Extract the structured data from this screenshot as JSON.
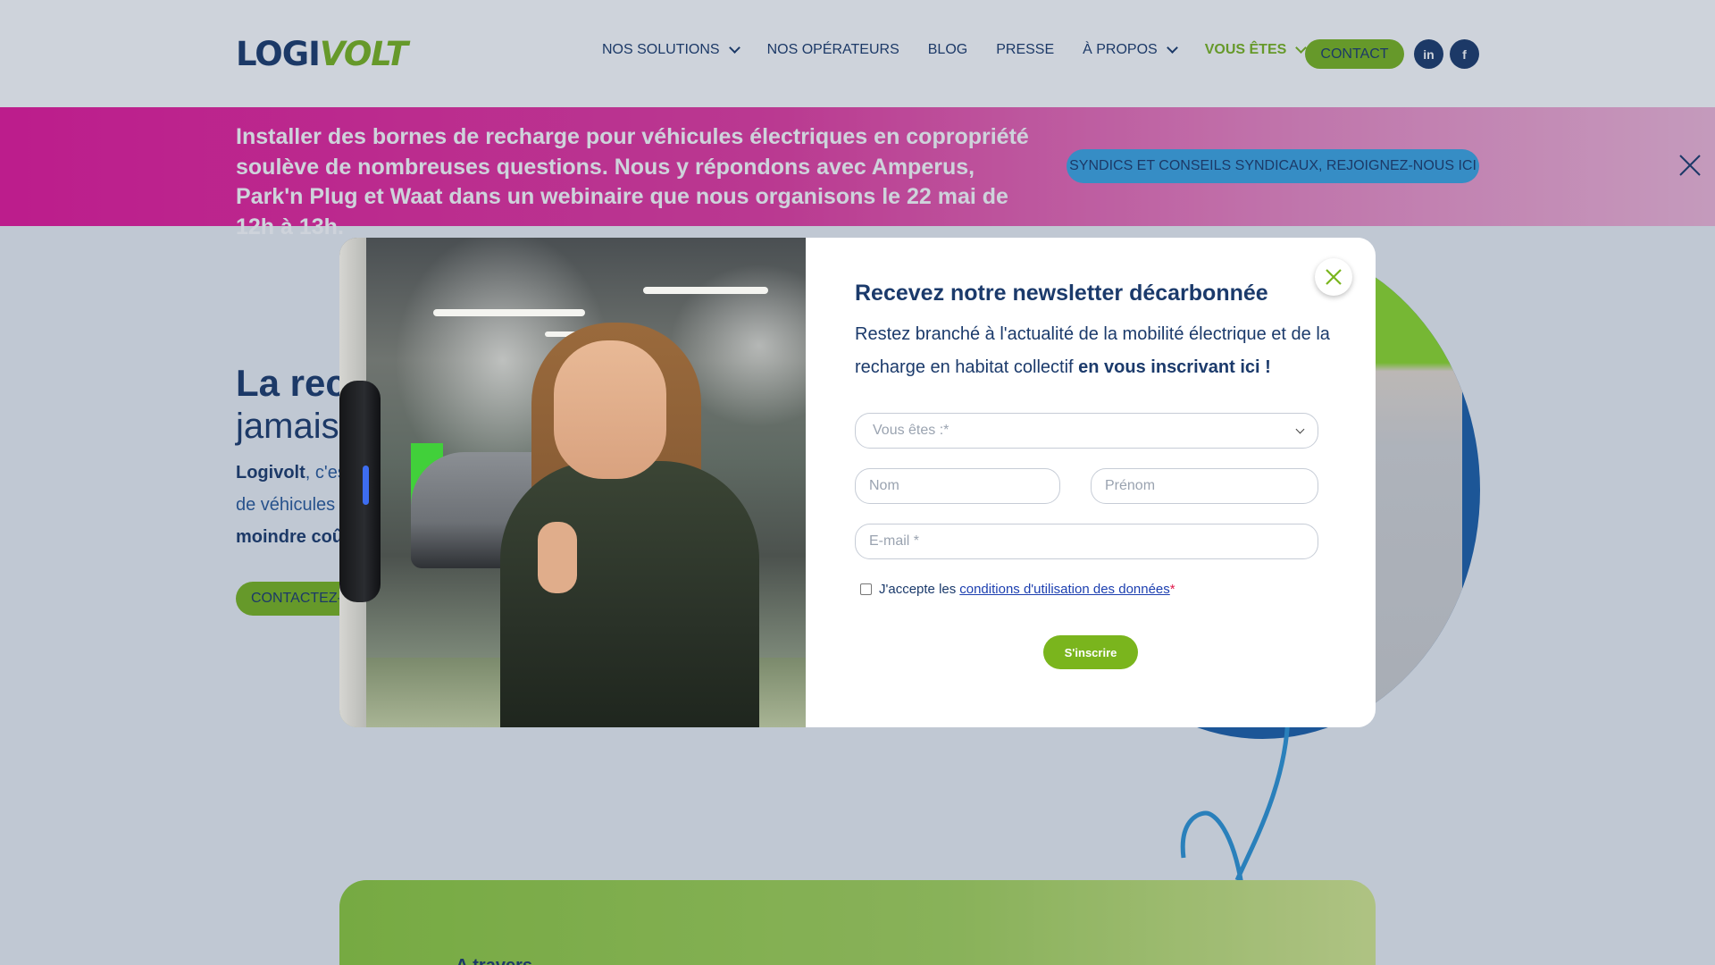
{
  "brand": {
    "logo_part1": "LOGI",
    "logo_part2": "VOLT",
    "primary_color": "#1b3a6b",
    "accent_color": "#7ab51d"
  },
  "nav": {
    "items": [
      {
        "label": "NOS SOLUTIONS",
        "dropdown": true
      },
      {
        "label": "NOS OPÉRATEURS",
        "dropdown": false
      },
      {
        "label": "BLOG",
        "dropdown": false
      },
      {
        "label": "PRESSE",
        "dropdown": false
      },
      {
        "label": "À PROPOS",
        "dropdown": true
      },
      {
        "label": "VOUS ÊTES",
        "dropdown": true,
        "active": true
      }
    ],
    "contact_label": "CONTACT",
    "social": [
      {
        "icon": "linkedin-icon",
        "glyph": "in"
      },
      {
        "icon": "facebook-icon",
        "glyph": "f"
      }
    ]
  },
  "banner": {
    "text": "Installer des bornes de recharge pour véhicules électriques en copropriété soulève de nombreuses questions. Nous y répondons avec Amperus, Park'n Plug et Waat dans un webinaire que nous organisons le 22 mai de 12h à 13h.",
    "button_label": "SYNDICS ET CONSEILS SYNDICAUX, REJOIGNEZ-NOUS ICI",
    "close_icon": "close-icon",
    "color": "#e8169a"
  },
  "hero": {
    "title_line1": "La rech",
    "title_line2": "jamais",
    "para_line1_bold": "Logivolt",
    "para_line1_rest": ", c'es",
    "para_line2": "de véhicules",
    "para_line3_bold": "moindre coû",
    "cta_label": "CONTACTEZ-"
  },
  "section": {
    "text_bold": "A travers",
    "text_rest": ""
  },
  "modal": {
    "title": "Recevez notre newsletter décarbonnée",
    "subtitle_text": "Restez branché à l'actualité de la mobilité électrique et de la recharge en habitat collectif",
    "subtitle_bold": "en vous inscrivant ici !",
    "select_placeholder": "Vous êtes :*",
    "nom_placeholder": "Nom",
    "prenom_placeholder": "Prénom",
    "email_placeholder": "E-mail *",
    "consent_prefix": "J'accepte les",
    "consent_link": "conditions d'utilisation des données",
    "consent_required": "*",
    "submit_label": "S'inscrire",
    "close_icon": "close-icon"
  }
}
